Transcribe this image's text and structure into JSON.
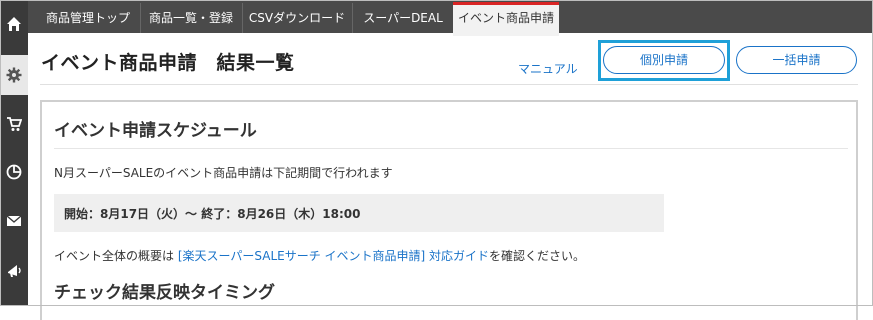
{
  "tabs": [
    {
      "label": "商品管理トップ"
    },
    {
      "label": "商品一覧・登録"
    },
    {
      "label": "CSVダウンロード"
    },
    {
      "label": "スーパーDEAL"
    },
    {
      "label": "イベント商品申請"
    }
  ],
  "sidebar": {
    "icons": [
      "home-icon",
      "gear-icon",
      "cart-icon",
      "pie-chart-icon",
      "mail-icon",
      "megaphone-icon"
    ]
  },
  "header": {
    "title": "イベント商品申請　結果一覧",
    "manual_link": "マニュアル",
    "individual_button": "個別申請",
    "bulk_button": "一括申請"
  },
  "schedule": {
    "title": "イベント申請スケジュール",
    "description": "N月スーパーSALEのイベント商品申請は下記期間で行われます",
    "period": "開始：8月17日（火）～ 終了：8月26日（木）18:00",
    "guide_prefix": "イベント全体の概要は ",
    "guide_link": "[楽天スーパーSALEサーチ イベント商品申請] 対応ガイド",
    "guide_suffix": "を確認ください。"
  },
  "timing": {
    "title": "チェック結果反映タイミング"
  },
  "colors": {
    "accent_blue": "#1a73c8",
    "highlight": "#1ea0d8",
    "active_tab_top": "#d92525",
    "sidebar_bg": "#3a3a3a",
    "topbar_bg": "#4a4a4a"
  }
}
